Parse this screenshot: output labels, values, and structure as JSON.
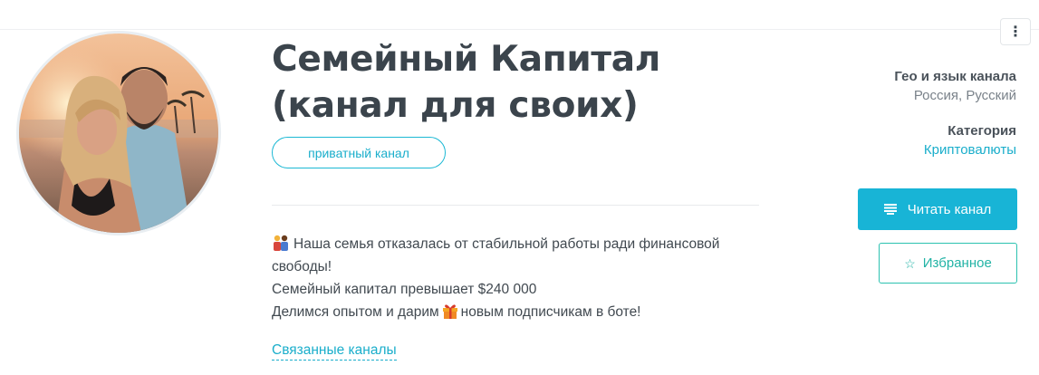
{
  "channel": {
    "title": "Семейный Капитал (канал для своих)",
    "badge": "приватный канал",
    "description": {
      "line1": "Наша семья отказалась от стабильной работы ради финансовой свободы!",
      "line2": "Семейный капитал превышает $240 000",
      "line3_before": "Делимся опытом и дарим",
      "line3_after": "новым подписчикам в боте!"
    },
    "related_link": "Связанные каналы"
  },
  "sidebar": {
    "geo_label": "Гео и язык канала",
    "geo_value": "Россия, Русский",
    "category_label": "Категория",
    "category_value": "Криптовалюты",
    "read_button": "Читать канал",
    "favorite_button": "Избранное"
  },
  "icons": {
    "more": "more-vertical-icon",
    "read": "list-icon",
    "favorite": "star-outline-icon",
    "couple": "couple-emoji",
    "gift": "gift-emoji"
  },
  "colors": {
    "accent": "#18b4d6",
    "favorite": "#22b3a5",
    "title": "#3b444c"
  }
}
